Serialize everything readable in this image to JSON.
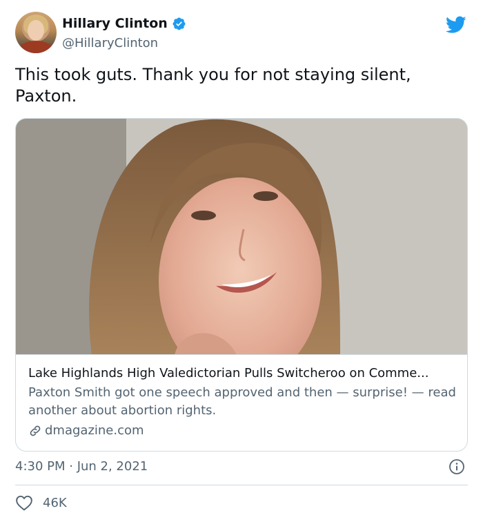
{
  "author": {
    "name": "Hillary Clinton",
    "handle": "@HillaryClinton",
    "verified": true,
    "avatar_icon": "avatar-photo"
  },
  "brand": {
    "icon": "twitter-bird-icon",
    "color": "#1d9bf0"
  },
  "tweet": {
    "text": "This took guts. Thank you for not staying silent, Paxton."
  },
  "card": {
    "image": "photo-of-smiling-young-woman-long-brown-hair",
    "title": "Lake Highlands High Valedictorian Pulls Switcheroo on Comme...",
    "description": "Paxton Smith got one speech approved and then — surprise! — read another about abortion rights.",
    "domain": "dmagazine.com"
  },
  "meta": {
    "timestamp": "4:30 PM · Jun 2, 2021"
  },
  "engagement": {
    "likes": "46K"
  },
  "colors": {
    "text_primary": "#0f1419",
    "text_secondary": "#536471",
    "border": "#cfd9de",
    "accent": "#1d9bf0"
  }
}
